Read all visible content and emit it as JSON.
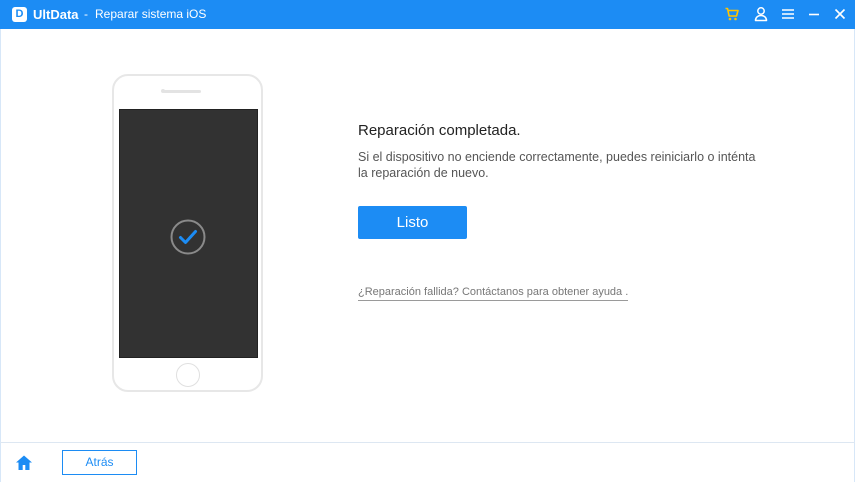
{
  "window": {
    "app_logo_letter": "D",
    "app_name": "UltData",
    "separator": "-",
    "module": "Reparar sistema iOS",
    "icons": [
      "cart-icon",
      "user-icon",
      "menu-icon",
      "minimize-icon",
      "close-icon"
    ],
    "accent_color": "#1c8cf4"
  },
  "result": {
    "title": "Reparación completada.",
    "description": "Si el dispositivo no enciende correctamente, puedes reiniciarlo o inténta la reparación de nuevo.",
    "done_label": "Listo",
    "help_link": "¿Reparación fallida? Contáctanos para obtener ayuda ."
  },
  "phone": {
    "status_icon": "check-circle-icon",
    "screen_color": "#323232",
    "check_color": "#1c8cf4"
  },
  "footer": {
    "home_icon": "home-icon",
    "back_label": "Atrás"
  }
}
